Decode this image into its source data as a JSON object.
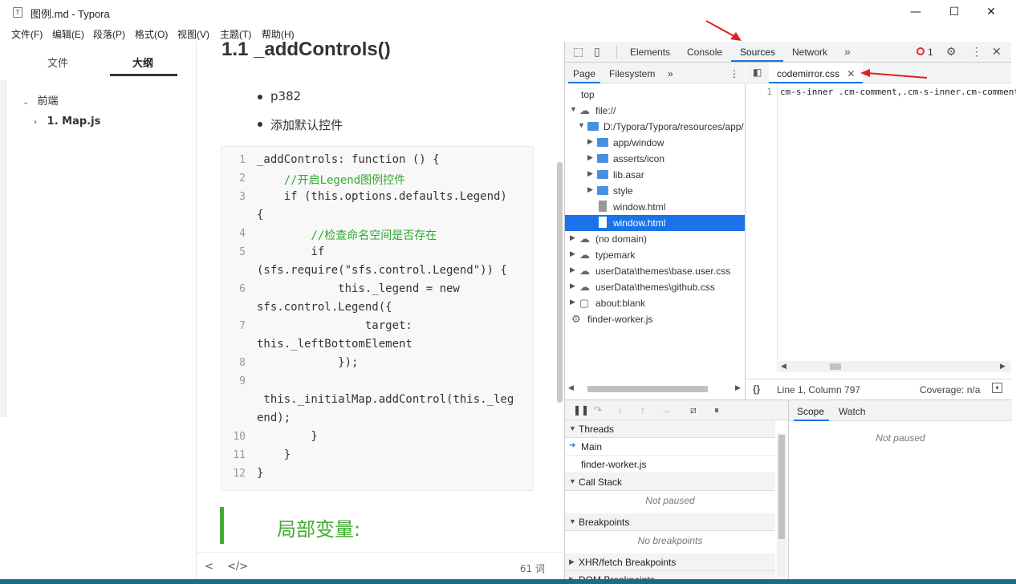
{
  "window": {
    "title": "图例.md - Typora",
    "min": "—",
    "max": "☐",
    "close": "✕"
  },
  "menu": [
    "文件(F)",
    "编辑(E)",
    "段落(P)",
    "格式(O)",
    "视图(V)",
    "主题(T)",
    "帮助(H)"
  ],
  "sidebar": {
    "tabs": [
      "文件",
      "大纲"
    ],
    "outline": [
      {
        "label": "前端"
      },
      {
        "label": "1. Map.js"
      }
    ]
  },
  "editor": {
    "heading": "1.1  _addControls()",
    "bullets": [
      "p382",
      "添加默认控件"
    ],
    "code_lines": [
      {
        "n": "1",
        "t": "_addControls: function () {"
      },
      {
        "n": "2",
        "t": "    //开启Legend图例控件"
      },
      {
        "n": "3",
        "t": "    if (this.options.defaults.Legend)"
      },
      {
        "n": "",
        "t": "{"
      },
      {
        "n": "4",
        "t": "        //检查命名空间是否存在"
      },
      {
        "n": "5",
        "t": "        if"
      },
      {
        "n": "",
        "t": "(sfs.require(\"sfs.control.Legend\")) {"
      },
      {
        "n": "6",
        "t": "            this._legend = new"
      },
      {
        "n": "",
        "t": "sfs.control.Legend({"
      },
      {
        "n": "7",
        "t": "                target:"
      },
      {
        "n": "",
        "t": "this._leftBottomElement"
      },
      {
        "n": "8",
        "t": "            });"
      },
      {
        "n": "9",
        "t": ""
      },
      {
        "n": "",
        "t": " this._initialMap.addControl(this._leg"
      },
      {
        "n": "",
        "t": "end);"
      },
      {
        "n": "10",
        "t": "        }"
      },
      {
        "n": "11",
        "t": "    }"
      },
      {
        "n": "12",
        "t": "}"
      }
    ],
    "quote": "局部变量:",
    "word_count": "61 词"
  },
  "devtools": {
    "tabs": [
      "Elements",
      "Console",
      "Sources",
      "Network"
    ],
    "error_count": "1",
    "subtabs": [
      "Page",
      "Filesystem"
    ],
    "tree": [
      {
        "label": "top"
      },
      {
        "label": "file://"
      },
      {
        "label": "D:/Typora/Typora/resources/app/"
      },
      {
        "label": "app/window"
      },
      {
        "label": "asserts/icon"
      },
      {
        "label": "lib.asar"
      },
      {
        "label": "style"
      },
      {
        "label": "window.html"
      },
      {
        "label": "window.html"
      },
      {
        "label": "(no domain)"
      },
      {
        "label": "typemark"
      },
      {
        "label": "userData\\themes\\base.user.css"
      },
      {
        "label": "userData\\themes\\github.css"
      },
      {
        "label": "about:blank"
      },
      {
        "label": "finder-worker.js"
      }
    ],
    "open_file": "codemirror.css",
    "code_line_no": "1",
    "code_text": "cm-s-inner .cm-comment,.cm-s-inner.cm-comment",
    "position": "Line 1, Column 797",
    "coverage": "Coverage: n/a",
    "sections": {
      "threads": "Threads",
      "main": "Main",
      "worker": "finder-worker.js",
      "callstack": "Call Stack",
      "not_paused": "Not paused",
      "breakpoints": "Breakpoints",
      "no_breakpoints": "No breakpoints",
      "xhr": "XHR/fetch Breakpoints",
      "dom": "DOM Breakpoints"
    },
    "scope_tabs": [
      "Scope",
      "Watch"
    ],
    "scope_status": "Not paused"
  }
}
